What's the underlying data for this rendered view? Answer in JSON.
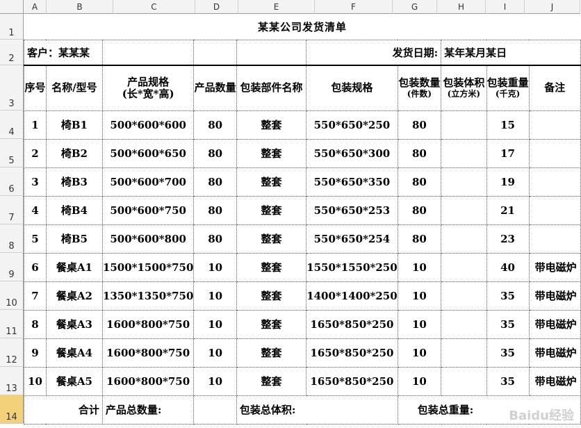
{
  "columns": [
    "A",
    "B",
    "C",
    "D",
    "E",
    "F",
    "G",
    "H",
    "I",
    "J"
  ],
  "rows_numbers": [
    "1",
    "2",
    "3",
    "4",
    "5",
    "6",
    "7",
    "8",
    "9",
    "10",
    "11",
    "12",
    "13",
    "14"
  ],
  "selected_row": "14",
  "title": "某某公司发货清单",
  "customer_label": "客户：某某某",
  "date_label": "发货日期:",
  "date_value": "某年某月某日",
  "headers": {
    "index": "序号",
    "name": "名称/型号",
    "spec_line1": "产品规格",
    "spec_line2": "(长*宽*高)",
    "qty": "产品数量",
    "parts": "包装部件名称",
    "pack_spec": "包装规格",
    "pack_qty": "包装数量",
    "pack_qty_unit": "(件数)",
    "pack_vol": "包装体积",
    "pack_vol_unit": "(立方米)",
    "pack_wt": "包装重量",
    "pack_wt_unit": "(千克)",
    "note": "备注"
  },
  "items": [
    {
      "no": "1",
      "name": "椅B1",
      "spec": "500*600*600",
      "qty": "80",
      "parts": "整套",
      "pack_spec": "550*650*250",
      "pack_qty": "80",
      "pack_vol": "",
      "pack_wt": "15",
      "note": ""
    },
    {
      "no": "2",
      "name": "椅B2",
      "spec": "500*600*650",
      "qty": "80",
      "parts": "整套",
      "pack_spec": "550*650*300",
      "pack_qty": "80",
      "pack_vol": "",
      "pack_wt": "17",
      "note": ""
    },
    {
      "no": "3",
      "name": "椅B3",
      "spec": "500*600*700",
      "qty": "80",
      "parts": "整套",
      "pack_spec": "550*650*350",
      "pack_qty": "80",
      "pack_vol": "",
      "pack_wt": "19",
      "note": ""
    },
    {
      "no": "4",
      "name": "椅B4",
      "spec": "500*600*750",
      "qty": "80",
      "parts": "整套",
      "pack_spec": "550*650*253",
      "pack_qty": "80",
      "pack_vol": "",
      "pack_wt": "21",
      "note": ""
    },
    {
      "no": "5",
      "name": "椅B5",
      "spec": "500*600*800",
      "qty": "80",
      "parts": "整套",
      "pack_spec": "550*650*254",
      "pack_qty": "80",
      "pack_vol": "",
      "pack_wt": "23",
      "note": ""
    },
    {
      "no": "6",
      "name": "餐桌A1",
      "spec": "1500*1500*750",
      "qty": "10",
      "parts": "整套",
      "pack_spec": "1550*1550*250",
      "pack_qty": "10",
      "pack_vol": "",
      "pack_wt": "40",
      "note": "带电磁炉"
    },
    {
      "no": "7",
      "name": "餐桌A2",
      "spec": "1350*1350*750",
      "qty": "10",
      "parts": "整套",
      "pack_spec": "1400*1400*250",
      "pack_qty": "10",
      "pack_vol": "",
      "pack_wt": "35",
      "note": "带电磁炉"
    },
    {
      "no": "8",
      "name": "餐桌A3",
      "spec": "1600*800*750",
      "qty": "10",
      "parts": "整套",
      "pack_spec": "1650*850*250",
      "pack_qty": "10",
      "pack_vol": "",
      "pack_wt": "35",
      "note": "带电磁炉"
    },
    {
      "no": "9",
      "name": "餐桌A4",
      "spec": "1600*800*750",
      "qty": "10",
      "parts": "整套",
      "pack_spec": "1650*850*250",
      "pack_qty": "10",
      "pack_vol": "",
      "pack_wt": "35",
      "note": "带电磁炉"
    },
    {
      "no": "10",
      "name": "餐桌A5",
      "spec": "1600*800*750",
      "qty": "10",
      "parts": "整套",
      "pack_spec": "1650*850*250",
      "pack_qty": "10",
      "pack_vol": "",
      "pack_wt": "35",
      "note": "带电磁炉"
    }
  ],
  "totals": {
    "label": "合计",
    "qty_label": "产品总数量:",
    "vol_label": "包装总体积:",
    "wt_label": "包装总重量:"
  },
  "watermark": "Baidu经验"
}
